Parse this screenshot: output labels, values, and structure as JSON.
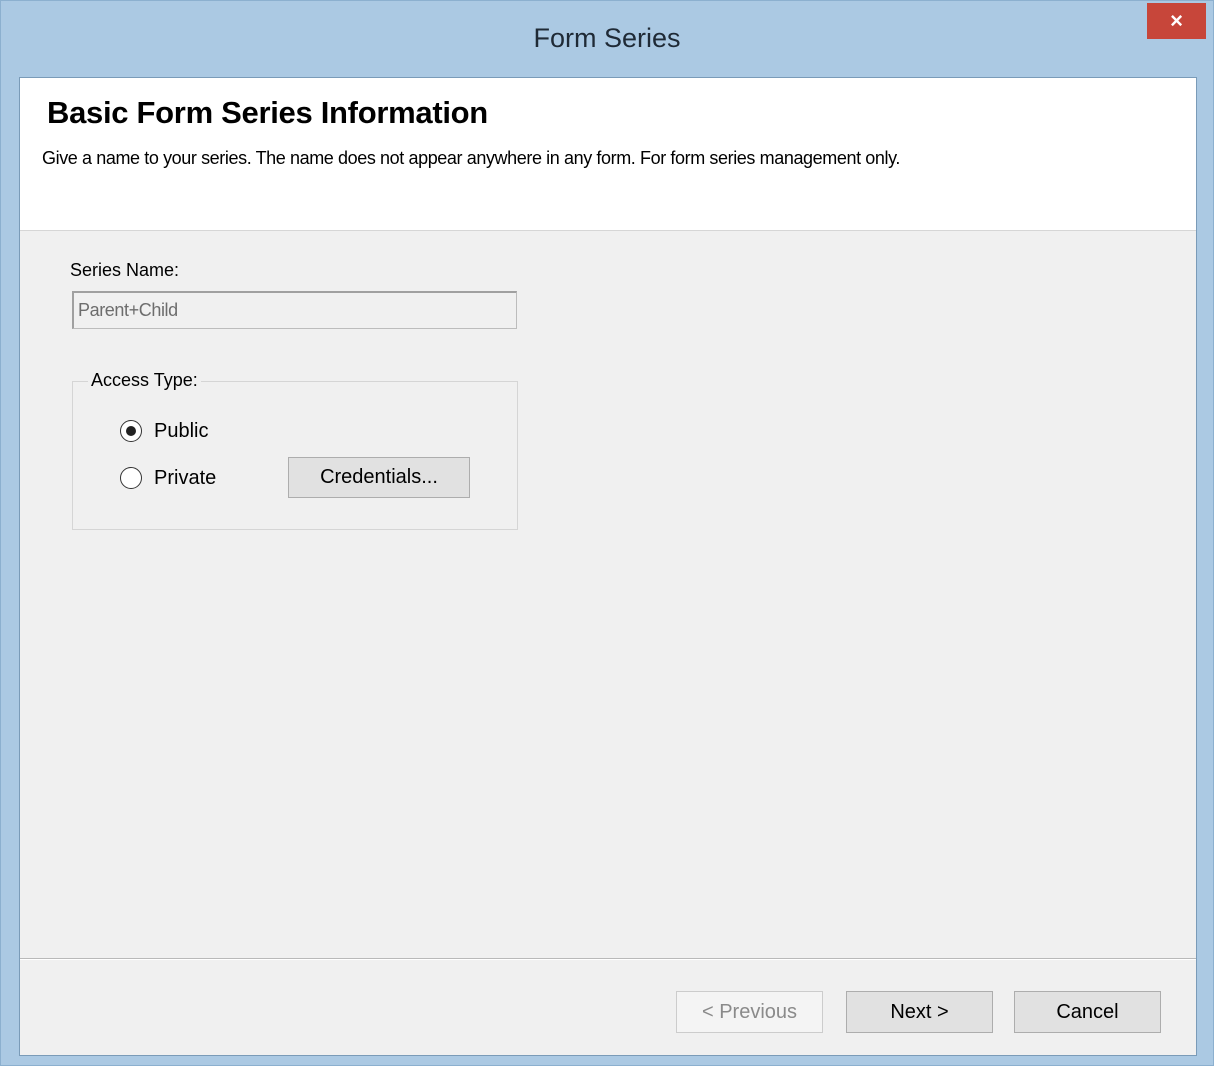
{
  "window": {
    "title": "Form Series",
    "close_label": "×"
  },
  "header": {
    "title": "Basic Form Series Information",
    "description": "Give a name to your series. The name does not appear anywhere in any form. For form series management only."
  },
  "series_name": {
    "label": "Series Name:",
    "value": "Parent+Child"
  },
  "access_type": {
    "legend": "Access Type:",
    "options": [
      {
        "label": "Public",
        "checked": true
      },
      {
        "label": "Private",
        "checked": false
      }
    ],
    "credentials_label": "Credentials..."
  },
  "footer": {
    "previous_label": "< Previous",
    "next_label": "Next >",
    "cancel_label": "Cancel"
  },
  "colors": {
    "titlebar": "#abc9e3",
    "close_button": "#c7463a",
    "dialog_background": "#f0f0f0"
  }
}
